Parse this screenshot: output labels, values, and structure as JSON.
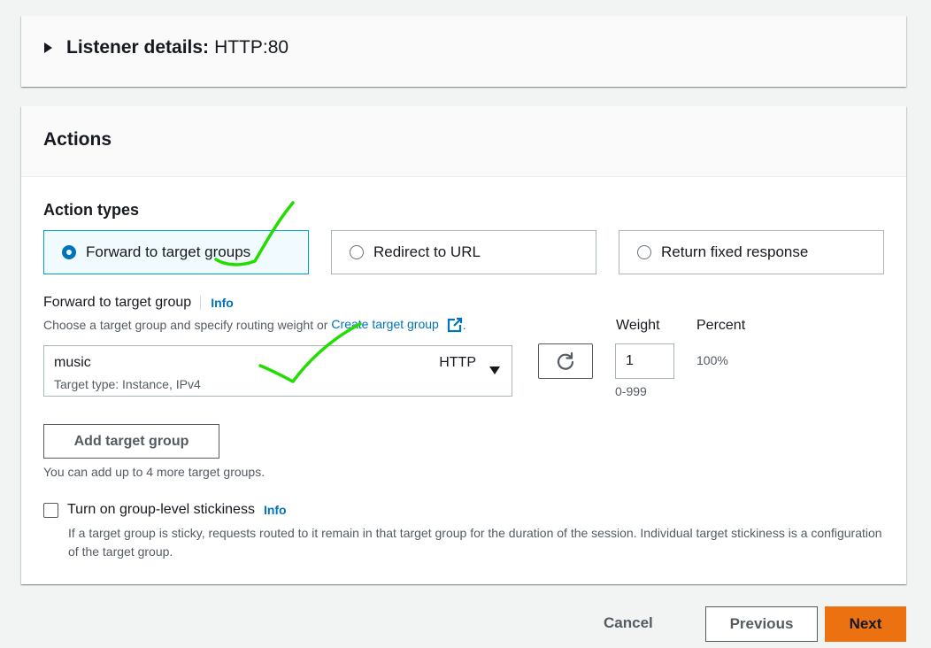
{
  "listener": {
    "label": "Listener details:",
    "value": "HTTP:80"
  },
  "actions": {
    "title": "Actions",
    "action_types_label": "Action types",
    "options": [
      {
        "label": "Forward to target groups",
        "selected": true
      },
      {
        "label": "Redirect to URL",
        "selected": false
      },
      {
        "label": "Return fixed response",
        "selected": false
      }
    ],
    "forward": {
      "label": "Forward to target group",
      "info": "Info",
      "description": "Choose a target group and specify routing weight or",
      "create_link": "Create target group",
      "description_end": ".",
      "target_group": {
        "name": "music",
        "type": "Target type: Instance, IPv4",
        "protocol": "HTTP"
      },
      "weight_label": "Weight",
      "weight_value": "1",
      "weight_hint": "0-999",
      "percent_label": "Percent",
      "percent_value": "100%"
    },
    "add_target_group": "Add target group",
    "add_hint": "You can add up to 4 more target groups.",
    "stickiness": {
      "label": "Turn on group-level stickiness",
      "info": "Info",
      "checked": false,
      "description": "If a target group is sticky, requests routed to it remain in that target group for the duration of the session. Individual target stickiness is a configuration of the target group."
    }
  },
  "footer": {
    "cancel": "Cancel",
    "previous": "Previous",
    "next": "Next"
  },
  "colors": {
    "accent": "#0073bb",
    "primary_button": "#ec7211",
    "annotation": "#22dd00"
  },
  "icons": {
    "expand": "caret-right-icon",
    "refresh": "refresh-icon",
    "external": "external-link-icon",
    "dropdown": "caret-down-icon"
  }
}
